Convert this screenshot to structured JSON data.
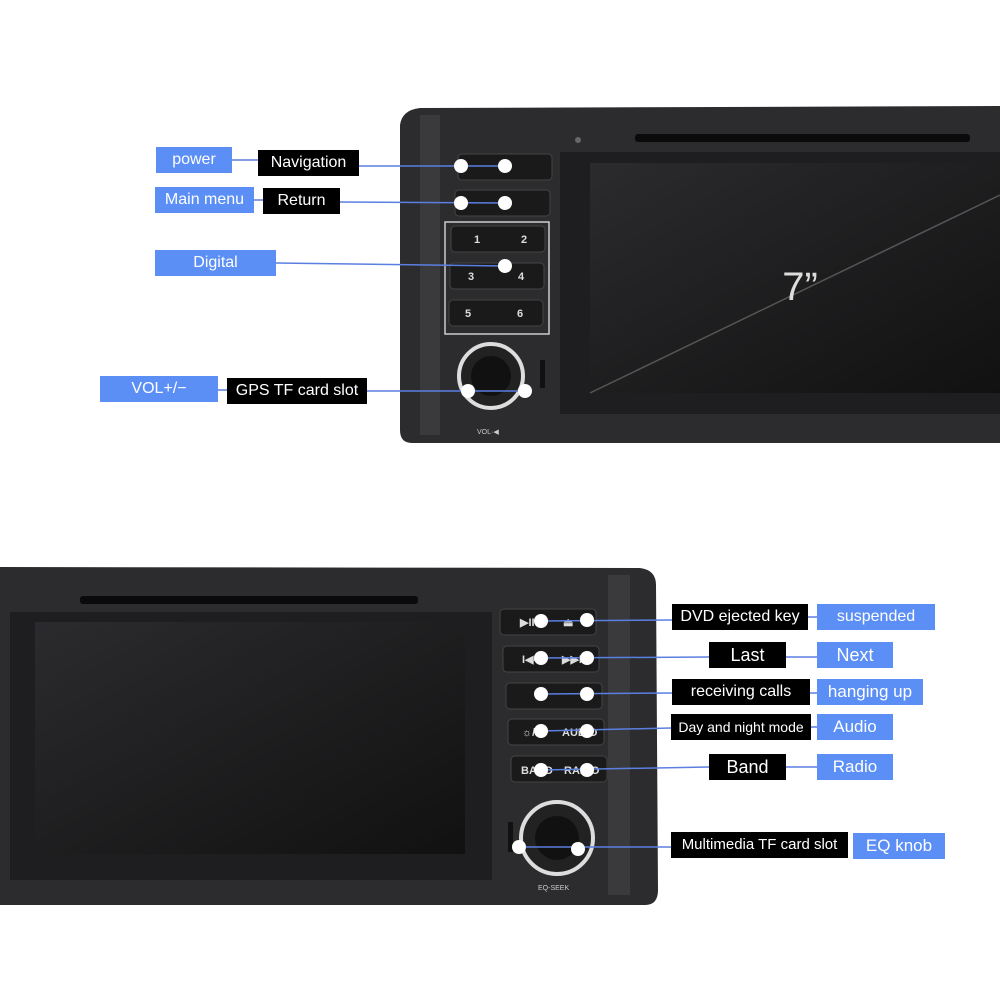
{
  "top_unit": {
    "screen_size": "7”",
    "labels": {
      "power": "power",
      "navigation": "Navigation",
      "main_menu": "Main menu",
      "return": "Return",
      "digital": "Digital",
      "vol": "VOL+/−",
      "gps_tf": "GPS TF card slot"
    },
    "buttons": {
      "digits": [
        "1",
        "2",
        "3",
        "4",
        "5",
        "6"
      ],
      "knob_label": "VOL·◀"
    }
  },
  "bottom_unit": {
    "labels": {
      "dvd_eject": "DVD ejected key",
      "suspended": "suspended",
      "last": "Last",
      "next": "Next",
      "receiving": "receiving calls",
      "hanging_up": "hanging up",
      "day_night": "Day and night mode",
      "audio": "Audio",
      "band": "Band",
      "radio": "Radio",
      "multimedia_tf": "Multimedia TF card slot",
      "eq_knob": "EQ knob"
    },
    "buttons": {
      "play_pause": "▶II",
      "eject": "⏏",
      "prev": "I◀◀",
      "next": "▶▶I",
      "audio": "AUDIO",
      "band": "BAND",
      "radio": "RADIO",
      "day_night": "☼/☾",
      "knob_label": "EQ-SEEK"
    }
  },
  "colors": {
    "label_blue": "#5b8ff5",
    "label_black": "#000000",
    "leader_line": "#5b7fe0",
    "device": "#2a2a2c"
  }
}
